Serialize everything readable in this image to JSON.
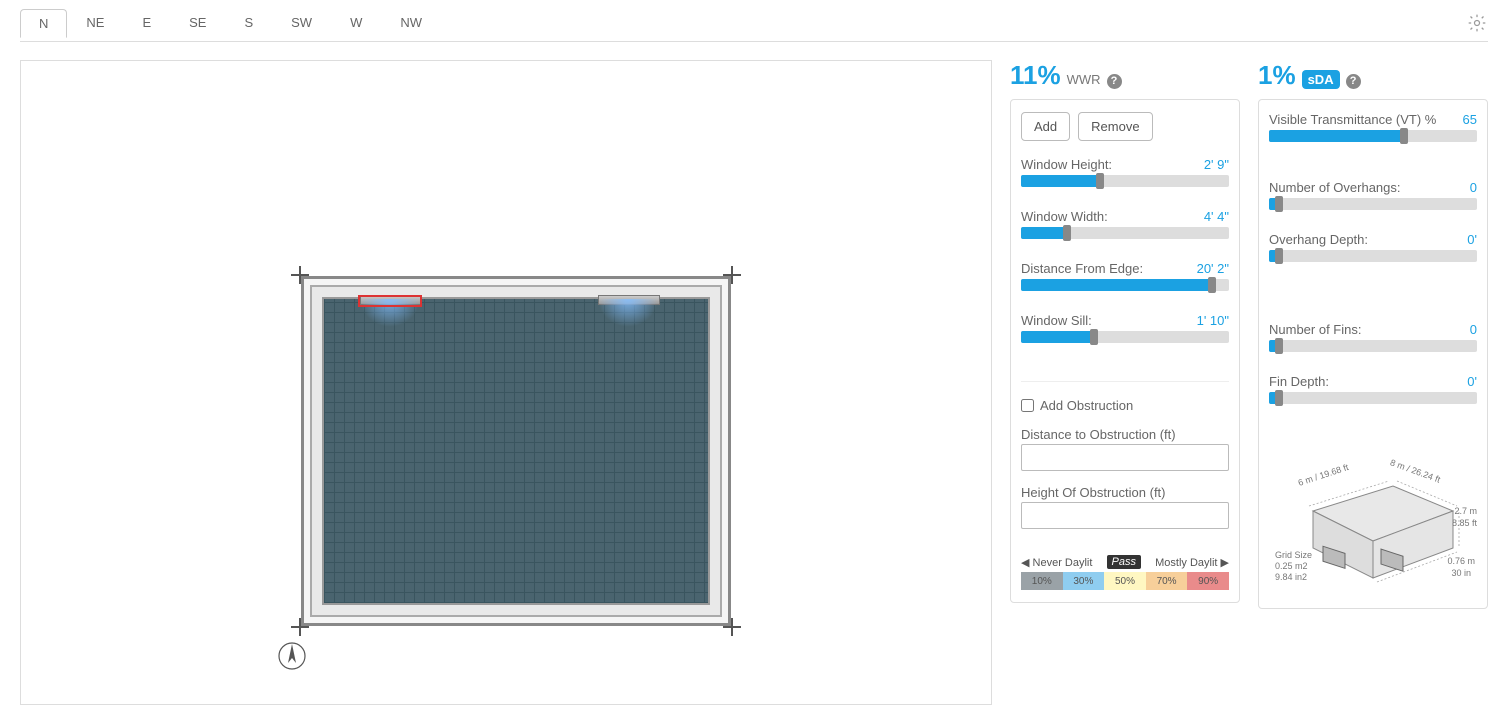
{
  "tabs": [
    "N",
    "NE",
    "E",
    "SE",
    "S",
    "SW",
    "W",
    "NW"
  ],
  "active_tab": "N",
  "wwr": {
    "pct": "11%",
    "label": "WWR"
  },
  "sda": {
    "pct": "1%",
    "badge": "sDA"
  },
  "buttons": {
    "add": "Add",
    "remove": "Remove"
  },
  "left_sliders": [
    {
      "label": "Window Height:",
      "value": "2' 9\"",
      "fill": 38
    },
    {
      "label": "Window Width:",
      "value": "4' 4\"",
      "fill": 22
    },
    {
      "label": "Distance From Edge:",
      "value": "20' 2\"",
      "fill": 92
    },
    {
      "label": "Window Sill:",
      "value": "1' 10\"",
      "fill": 35
    }
  ],
  "obstruction": {
    "checkbox": "Add Obstruction",
    "dist_label": "Distance to Obstruction (ft)",
    "height_label": "Height Of Obstruction (ft)"
  },
  "legend": {
    "left": "Never Daylit",
    "mid": "Pass",
    "right": "Mostly Daylit",
    "segs": [
      {
        "t": "10%",
        "c": "#9aa2a7"
      },
      {
        "t": "30%",
        "c": "#8fcdf0"
      },
      {
        "t": "50%",
        "c": "#fff7c2"
      },
      {
        "t": "70%",
        "c": "#f7cf9a"
      },
      {
        "t": "90%",
        "c": "#e98b8b"
      }
    ]
  },
  "right_sliders_top": {
    "label": "Visible Transmittance (VT) %",
    "value": "65",
    "fill": 65
  },
  "right_sliders_b": [
    {
      "label": "Number of Overhangs:",
      "value": "0",
      "fill": 5
    },
    {
      "label": "Overhang Depth:",
      "value": "0'",
      "fill": 5
    }
  ],
  "right_sliders_c": [
    {
      "label": "Number of Fins:",
      "value": "0",
      "fill": 5
    },
    {
      "label": "Fin Depth:",
      "value": "0'",
      "fill": 5
    }
  ],
  "diagram_labels": {
    "dim_a": "6 m / 19.68 ft",
    "dim_b": "8 m / 26.24 ft",
    "h1": "2.7 m",
    "h2": "8.85 ft",
    "grid1": "Grid Size",
    "grid2": "0.25 m2",
    "grid3": "9.84 in2",
    "d1": "0.76 m",
    "d2": "30 in"
  }
}
